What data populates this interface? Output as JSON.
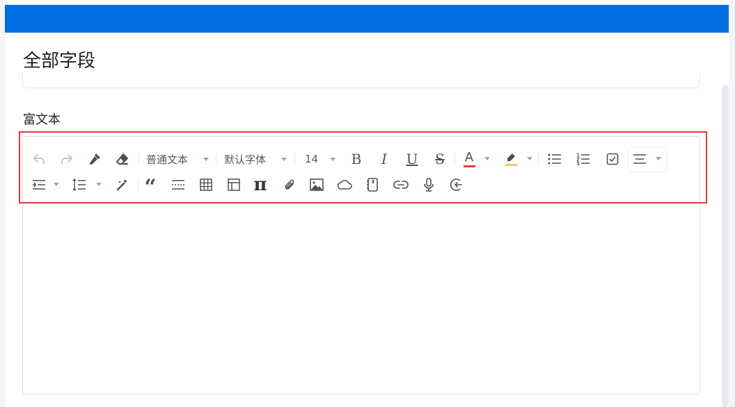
{
  "page": {
    "title": "全部字段"
  },
  "field": {
    "label": "富文本"
  },
  "toolbar": {
    "block_format": {
      "value": "普通文本"
    },
    "font_family": {
      "value": "默认字体"
    },
    "font_size": {
      "value": "14"
    },
    "bold_glyph": "B",
    "italic_glyph": "I",
    "underline_glyph": "U",
    "strike_glyph": "S",
    "font_color_glyph": "A",
    "quote_glyph": "“",
    "pi_glyph": "π"
  },
  "colors": {
    "topbar": "#006ee1",
    "highlight_border": "#e5383b",
    "font_color_bar": "#e33e33",
    "highlight_color_bar": "#f5c366"
  }
}
